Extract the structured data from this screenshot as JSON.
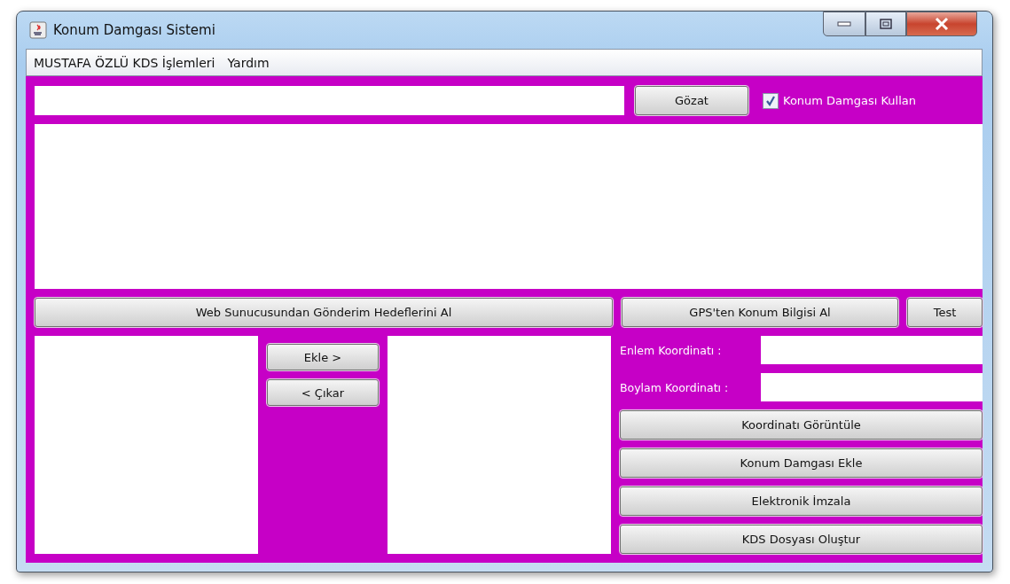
{
  "window": {
    "title": "Konum Damgası Sistemi"
  },
  "menu": [
    "MUSTAFA ÖZLÜ KDS İşlemleri",
    "Yardım"
  ],
  "file_row": {
    "browse": "Gözat",
    "use_stamp": {
      "label": "Konum Damgası Kullan",
      "checked": true
    }
  },
  "action_row": {
    "fetch_targets": "Web Sunucusundan Gönderim Hedeflerini Al",
    "gps": "GPS'ten Konum Bilgisi Al",
    "test": "Test"
  },
  "transfer": {
    "add": "Ekle >",
    "remove": "< Çıkar"
  },
  "coordinates": [
    {
      "label": "Enlem Koordinatı :"
    },
    {
      "label": "Boylam Koordinatı :"
    }
  ],
  "actions": [
    "Koordinatı Görüntüle",
    "Konum Damgası Ekle",
    "Elektronik İmzala",
    "KDS Dosyası Oluştur"
  ]
}
